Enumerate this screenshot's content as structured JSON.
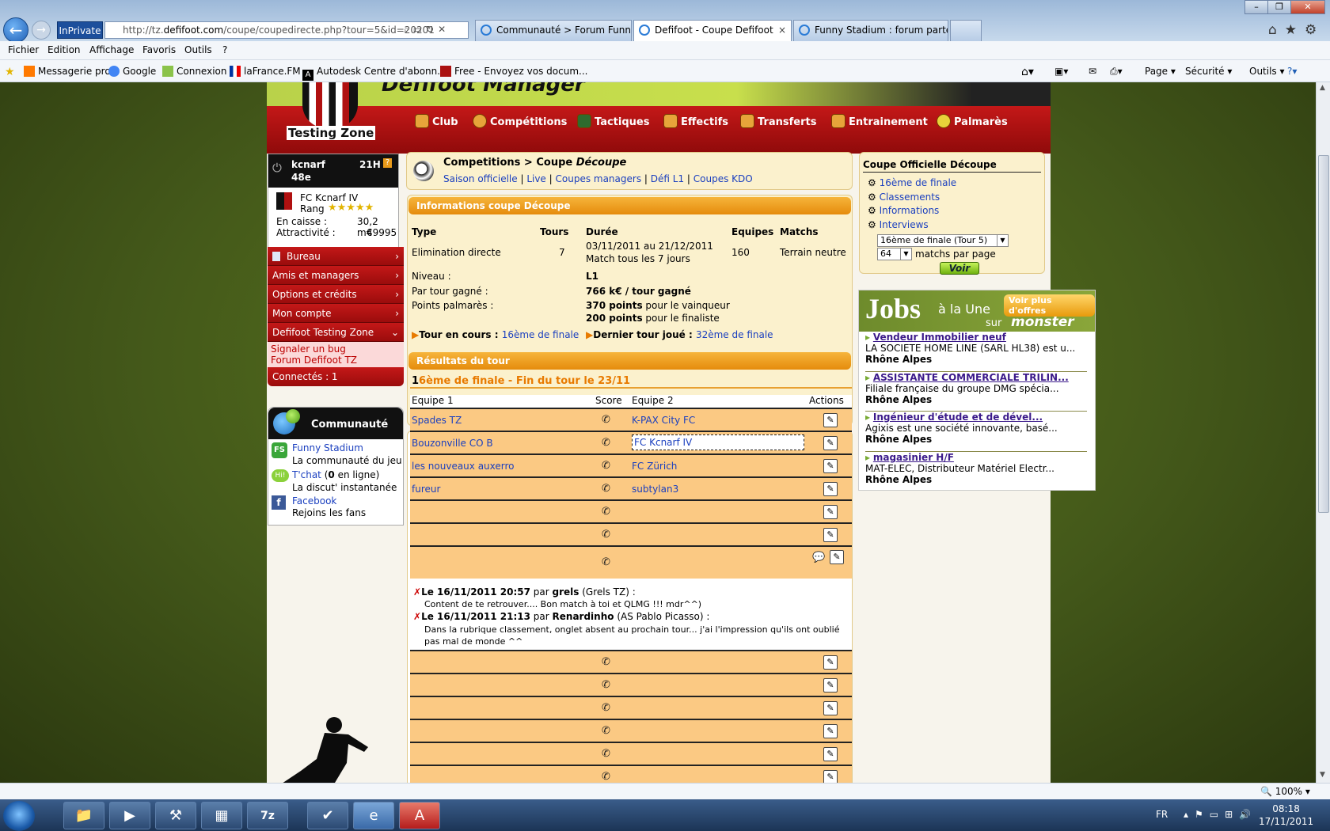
{
  "browser": {
    "inprivate": "InPrivate",
    "url_prefix": "http://tz.",
    "url_domain": "defifoot.com",
    "url_rest": "/coupe/coupedirecte.php?tour=5&id=20201",
    "tabs": [
      {
        "label": "Communauté > Forum Funny ..."
      },
      {
        "label": "Defifoot - Coupe Defifoot"
      },
      {
        "label": "Funny Stadium : forum parten..."
      }
    ],
    "menu": [
      "Fichier",
      "Edition",
      "Affichage",
      "Favoris",
      "Outils",
      "?"
    ],
    "favorites": [
      "Messagerie pro",
      "Google",
      "Connexion",
      "laFrance.FM",
      "Autodesk Centre d'abonn...",
      "Free - Envoyez vos docum..."
    ],
    "commands": [
      "Page",
      "Sécurité",
      "Outils"
    ],
    "zoom": "100%"
  },
  "site": {
    "banner_title": "Defifoot Manager",
    "zone_label": "Testing Zone",
    "nav": [
      "Club",
      "Compétitions",
      "Tactiques",
      "Effectifs",
      "Transferts",
      "Entrainement",
      "Palmarès"
    ]
  },
  "user": {
    "name": "kcnarf",
    "rank_num": "48e",
    "time": "21H",
    "club": "FC Kcnarf IV",
    "rang_label": "Rang",
    "stars": "★★★★★",
    "caisse_label": "En caisse :",
    "caisse_value": "30,2 m€",
    "attract_label": "Attractivité :",
    "attract_value": "49995"
  },
  "left_menu": {
    "items": [
      "Bureau",
      "Amis et managers",
      "Options et crédits",
      "Mon compte",
      "Defifoot Testing Zone"
    ],
    "sub": [
      "Signaler un bug",
      "Forum Defifoot TZ"
    ],
    "connectes": "Connectés : 1"
  },
  "communaute": {
    "title": "Communauté",
    "items": [
      {
        "link": "Funny Stadium",
        "desc": "La communauté du jeu"
      },
      {
        "link": "T'chat",
        "desc_count": "0",
        "desc_suffix": " en ligne)",
        "desc_prefix": "(",
        "desc": "La discut' instantanée"
      },
      {
        "link": "Facebook",
        "desc": "Rejoins les fans"
      }
    ]
  },
  "header": {
    "breadcrumb": "Competitions > Coupe ",
    "breadcrumb_em": "Découpe",
    "links": [
      "Saison officielle",
      "Live",
      "Coupes managers",
      "Défi L1",
      "Coupes KDO"
    ]
  },
  "info": {
    "title": "Informations coupe Découpe",
    "cols": [
      "Type",
      "Tours",
      "Durée",
      "Equipes",
      "Matchs"
    ],
    "type": "Elimination directe",
    "tours": "7",
    "duree": "03/11/2011 au 21/12/2011",
    "duree2": "Match tous les 7 jours",
    "equipes": "160",
    "matchs": "Terrain neutre",
    "niveau_label": "Niveau :",
    "niveau": "L1",
    "par_tour_label": "Par tour gagné :",
    "par_tour": "766 k€ / tour gagné",
    "points_label": "Points palmarès :",
    "points1": "370 points",
    "points1_suffix": " pour le vainqueur",
    "points2": "200 points",
    "points2_suffix": " pour le finaliste",
    "tour_en_cours_label": "Tour en cours : ",
    "tour_en_cours": "16ème de finale",
    "dernier_label": "Dernier tour joué : ",
    "dernier": "32ème de finale"
  },
  "results": {
    "title": "Résultats du tour",
    "subtitle_num": "1",
    "subtitle": "6ème de finale - Fin du tour le 23/11",
    "cols": [
      "Equipe 1",
      "Score",
      "Equipe 2",
      "Actions"
    ],
    "rows": [
      {
        "team1": "Spades TZ",
        "team2": "K-PAX City FC"
      },
      {
        "team1": "Bouzonville CO B",
        "team2": "FC Kcnarf IV"
      },
      {
        "team1": "les nouveaux auxerro",
        "team2": "FC Zürich"
      },
      {
        "team1": "fureur",
        "team2": "subtylan3"
      }
    ],
    "comments": [
      {
        "date": "Le 16/11/2011 20:57",
        "par": " par ",
        "author": "grels",
        "club": " (Grels TZ) :",
        "text": "Content de te retrouver.... Bon match à toi et QLMG !!! mdr^^)"
      },
      {
        "date": "Le 16/11/2011 21:13",
        "par": " par ",
        "author": "Renardinho",
        "club": " (AS Pablo Picasso) :",
        "text": "Dans la rubrique classement, onglet absent au prochain tour... j'ai l'impression qu'ils ont oublié pas mal de monde ^^"
      }
    ]
  },
  "right": {
    "title": "Coupe Officielle Découpe",
    "links": [
      "16ème de finale",
      "Classements",
      "Informations",
      "Interviews"
    ],
    "select_round": "16ème de finale (Tour 5)",
    "select_count": "64",
    "per_page": "matchs par page",
    "voir": "Voir"
  },
  "jobs": {
    "brand": "Jobs",
    "tag": "à la Une",
    "sur": "sur",
    "monster": "monster",
    "more": "Voir plus d'offres",
    "items": [
      {
        "title": "Vendeur Immobilier neuf",
        "company": "LA SOCIETE HOME LINE (SARL HL38) est u...",
        "region": "Rhône Alpes"
      },
      {
        "title": "ASSISTANTE COMMERCIALE TRILIN...",
        "company": "Filiale française du groupe DMG spécia...",
        "region": "Rhône Alpes"
      },
      {
        "title": "Ingénieur d'étude et de dével...",
        "company": "Agixis est une société innovante, basé...",
        "region": "Rhône Alpes"
      },
      {
        "title": "magasinier H/F",
        "company": "MAT-ELEC, Distributeur Matériel Electr...",
        "region": "Rhône Alpes"
      }
    ]
  },
  "taskbar": {
    "lang": "FR",
    "time": "08:18",
    "date": "17/11/2011"
  }
}
